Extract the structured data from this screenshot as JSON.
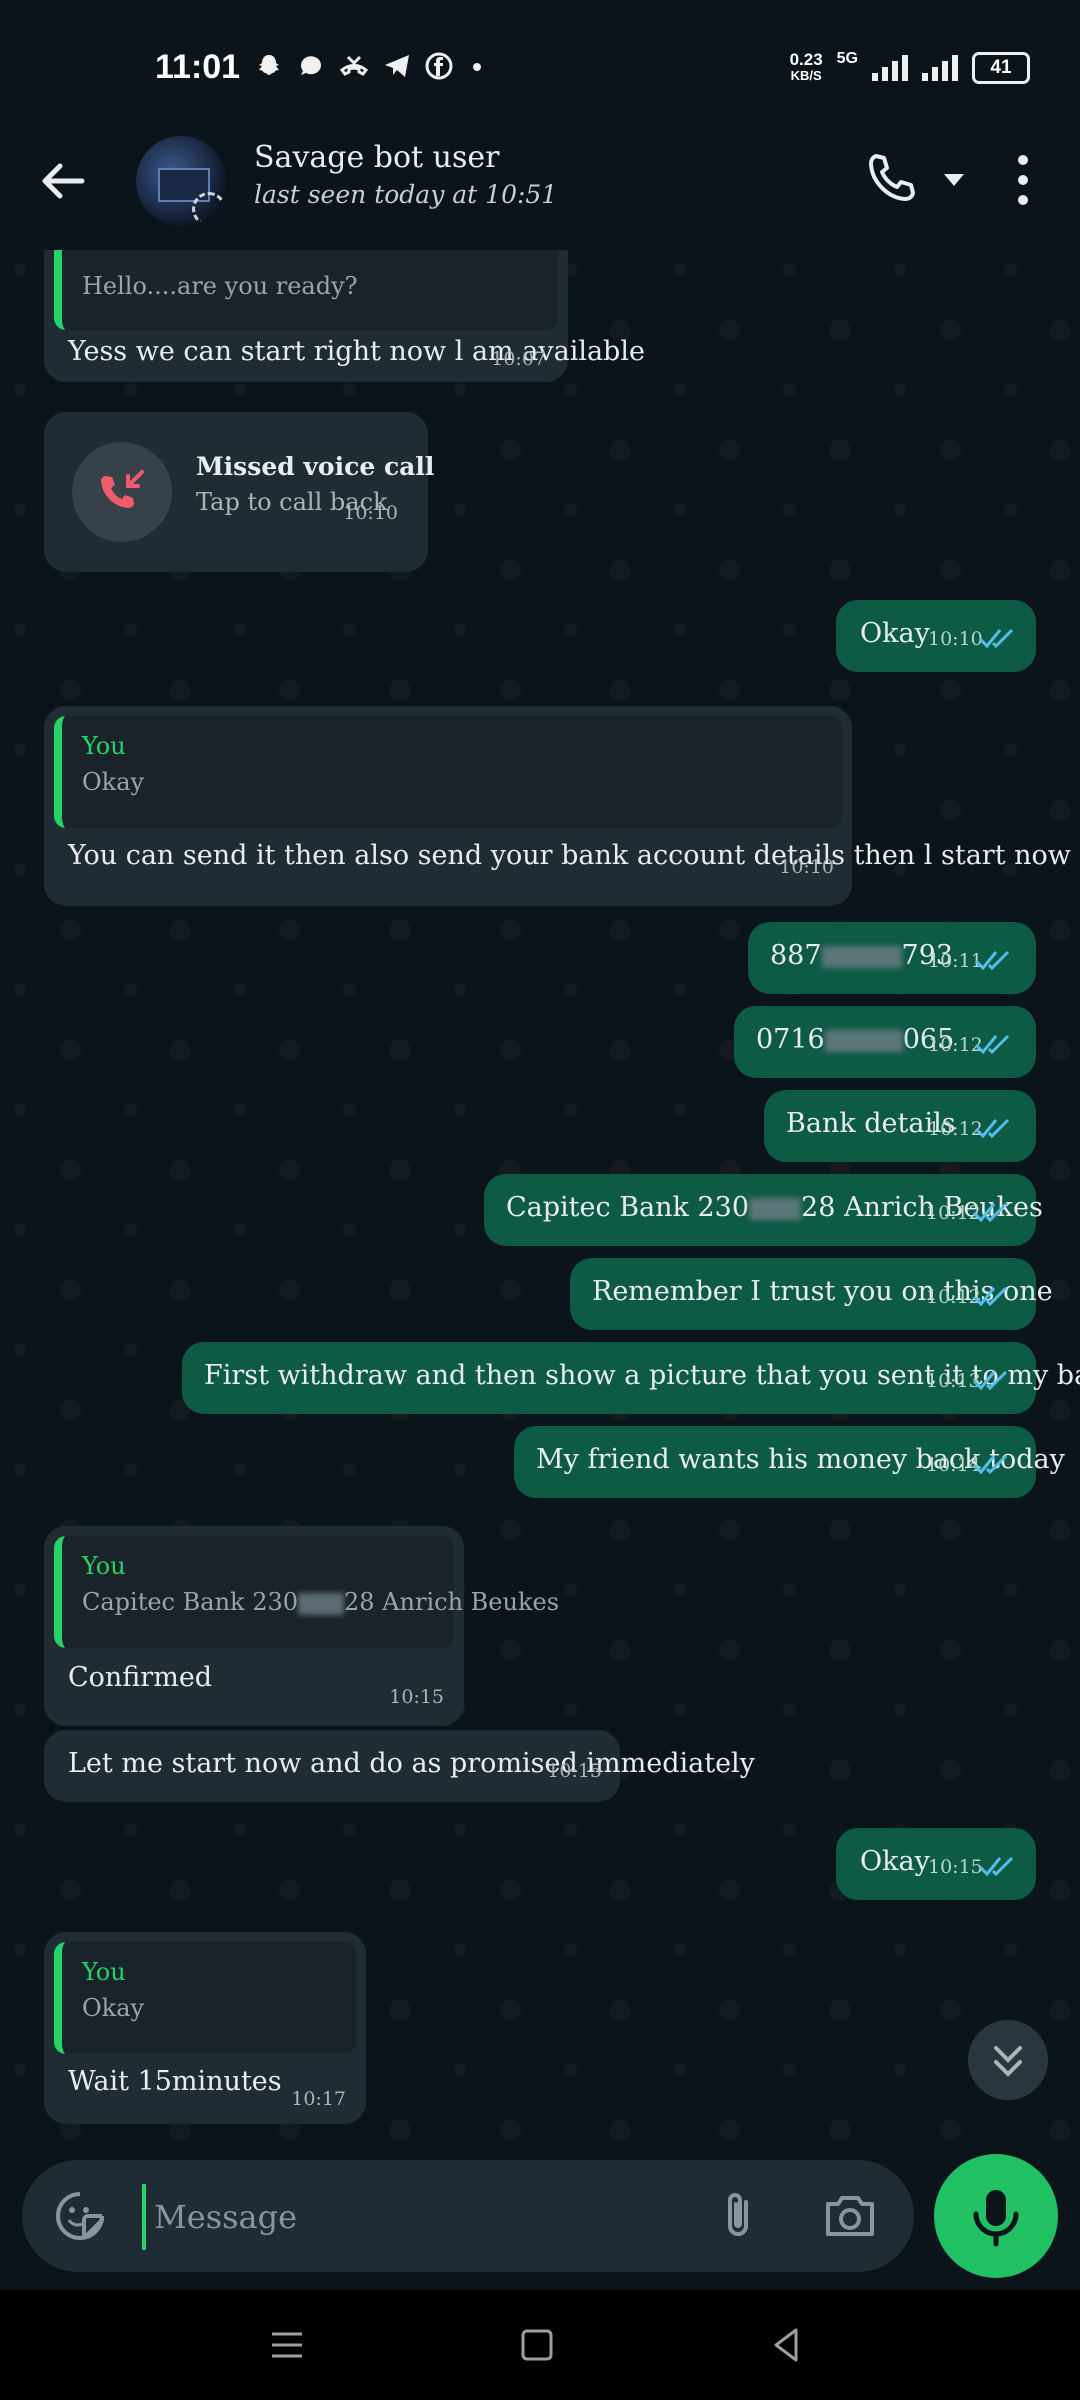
{
  "status": {
    "time": "11:01",
    "icons": [
      "snapchat-icon",
      "chat-icon",
      "missed-call-icon",
      "telegram-icon",
      "facebook-icon",
      "dot-icon"
    ],
    "net_speed": "0.23",
    "net_unit": "KB/S",
    "network_type": "5G",
    "battery": "41"
  },
  "header": {
    "contact_name": "Savage bot user",
    "last_seen": "last seen today at 10:51"
  },
  "messages": [
    {
      "quote_text": "Hello....are you ready?",
      "text": "Yess we can start right now l am available",
      "time": "10:07"
    },
    {
      "call_title": "Missed voice call",
      "call_sub": "Tap to call back",
      "time": "10:10"
    },
    {
      "text": "Okay",
      "time": "10:10"
    },
    {
      "quote_author": "You",
      "quote_text": "Okay",
      "text": "You can send it then also send your bank account details then l start now",
      "time": "10:10"
    },
    {
      "text_a": "887",
      "text_b": "793",
      "time": "10:11"
    },
    {
      "text_a": "0716",
      "text_b": "065",
      "time": "10:12"
    },
    {
      "text": "Bank details",
      "time": "10:12"
    },
    {
      "text_a": "Capitec Bank 230",
      "text_b": "28 Anrich Beukes",
      "time": "10:12"
    },
    {
      "text": "Remember I trust you on this one",
      "time": "10:12"
    },
    {
      "text": "First withdraw and then show a picture that you sent it to my bank account",
      "time": "10:13"
    },
    {
      "text": "My friend wants his money back today",
      "time": "10:14"
    },
    {
      "quote_author": "You",
      "quote_a": "Capitec Bank 230",
      "quote_b": "28 Anrich Beukes",
      "text": "Confirmed",
      "time": "10:15"
    },
    {
      "text": "Let me start now and do as promised immediately",
      "time": "10:15"
    },
    {
      "text": "Okay",
      "time": "10:15"
    },
    {
      "quote_author": "You",
      "quote_text": "Okay",
      "text": "Wait 15minutes",
      "time": "10:17"
    }
  ],
  "composer": {
    "placeholder": "Message"
  },
  "colors": {
    "background": "#0b141a",
    "incoming_bubble": "#202c33",
    "outgoing_bubble": "#0d5a45",
    "accent": "#25d366",
    "read_ticks": "#53bdeb",
    "missed_call": "#f15c6d"
  }
}
